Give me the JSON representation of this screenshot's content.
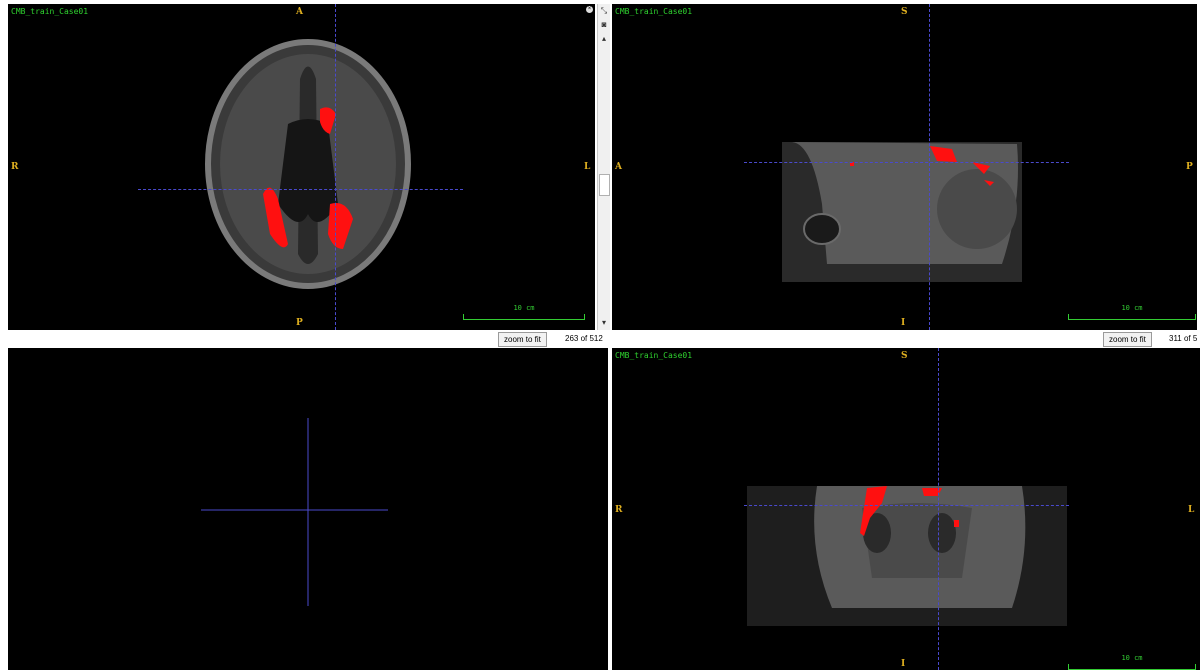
{
  "viewports": [
    {
      "id": "axial",
      "title": "CMB_train_Case01",
      "orient": {
        "top": "A",
        "bottom": "P",
        "left": "R",
        "right": "L"
      },
      "scale": "10 cm"
    },
    {
      "id": "sagittal",
      "title": "CMB_train_Case01",
      "orient": {
        "top": "S",
        "bottom": "I",
        "left": "A",
        "right": "P"
      },
      "scale": "10 cm"
    },
    {
      "id": "coronal",
      "title": "CMB_train_Case01",
      "orient": {
        "top": "S",
        "bottom": "I",
        "left": "R",
        "right": "L"
      },
      "scale": "10 cm"
    }
  ],
  "status": [
    {
      "zoom_label": "zoom to fit",
      "slice": "263 of 512"
    },
    {
      "zoom_label": "zoom to fit",
      "slice": "311 of 5"
    }
  ],
  "icons": [
    "restore-icon",
    "camera-icon",
    "scroll-up-icon",
    "scroll-down-icon",
    "close-icon"
  ],
  "colors": {
    "background": "#000000",
    "crosshair": "#4a4acd",
    "mask": "#ff1010",
    "label": "#e0b020",
    "title": "#2fd22f"
  }
}
